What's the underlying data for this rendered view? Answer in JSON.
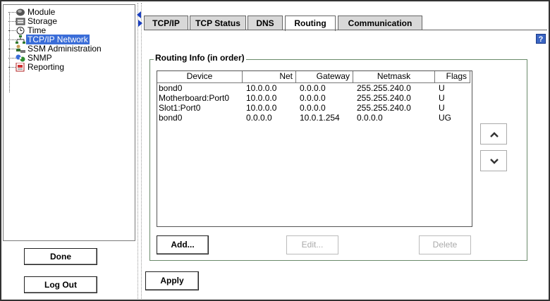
{
  "tree": {
    "items": [
      {
        "label": "Module",
        "icon": "module-icon"
      },
      {
        "label": "Storage",
        "icon": "storage-icon"
      },
      {
        "label": "Time",
        "icon": "clock-icon"
      },
      {
        "label": "TCP/IP Network",
        "icon": "network-icon",
        "selected": true
      },
      {
        "label": "SSM Administration",
        "icon": "admin-icon"
      },
      {
        "label": "SNMP",
        "icon": "snmp-icon"
      },
      {
        "label": "Reporting",
        "icon": "report-icon"
      }
    ]
  },
  "left_buttons": {
    "done": "Done",
    "logout": "Log Out"
  },
  "tabs": [
    {
      "label": "TCP/IP"
    },
    {
      "label": "TCP Status"
    },
    {
      "label": "DNS"
    },
    {
      "label": "Routing",
      "active": true
    },
    {
      "label": "Communication"
    }
  ],
  "help": {
    "label": "?"
  },
  "routing": {
    "title": "Routing Info (in order)",
    "columns": [
      "Device",
      "Net",
      "Gateway",
      "Netmask",
      "Flags"
    ],
    "rows": [
      [
        "bond0",
        "10.0.0.0",
        "0.0.0.0",
        "255.255.240.0",
        "U"
      ],
      [
        "Motherboard:Port0",
        "10.0.0.0",
        "0.0.0.0",
        "255.255.240.0",
        "U"
      ],
      [
        "Slot1:Port0",
        "10.0.0.0",
        "0.0.0.0",
        "255.255.240.0",
        "U"
      ],
      [
        "bond0",
        "0.0.0.0",
        "10.0.1.254",
        "0.0.0.0",
        "UG"
      ]
    ],
    "buttons": {
      "add": "Add...",
      "edit": "Edit...",
      "delete": "Delete"
    },
    "move_up_icon": "chevron-up-icon",
    "move_down_icon": "chevron-down-icon"
  },
  "apply_label": "Apply",
  "colors": {
    "selection": "#3a6dd8",
    "help": "#3b66c4",
    "group_border": "#6a8a6a"
  }
}
